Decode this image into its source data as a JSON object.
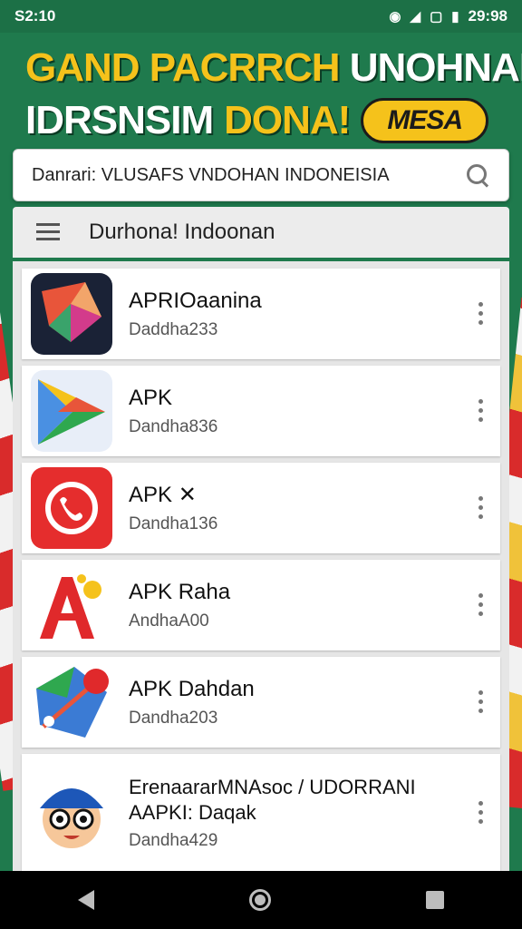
{
  "status_bar": {
    "time": "S2:10",
    "clock_right": "29:98"
  },
  "banner": {
    "line1_yellow": "GAND PACRRCH",
    "line1_white": "UNOHNAN",
    "line2_white": "IDRSNSIM",
    "line2_yellow": "DONA!",
    "pill": "MESA"
  },
  "search": {
    "value": "Danrari: VLUSAFS VNDOHAN INDONEISIA"
  },
  "title_bar": {
    "title": "Durhona! Indoonan"
  },
  "apps": [
    {
      "name": "APRIOaanina",
      "sub": "Daddha233",
      "icon": "origami-app-icon"
    },
    {
      "name": "APK",
      "sub": "Dandha836",
      "icon": "play-triangle-app-icon"
    },
    {
      "name": "APK ✕",
      "sub": "Dandha136",
      "icon": "phone-app-icon"
    },
    {
      "name": "APK Raha",
      "sub": "AndhaA00",
      "icon": "letter-a-app-icon"
    },
    {
      "name": "APK Dahdan",
      "sub": "Dandha203",
      "icon": "map-app-icon"
    },
    {
      "name": "ErenaararMNAsoc / UDORRANI",
      "name2": "AAPKI: Daqak",
      "sub": "Dandha429",
      "icon": "mascot-app-icon"
    }
  ],
  "colors": {
    "background": "#1f7a4d",
    "banner_yellow": "#f5c21b",
    "nav_bar": "#000000"
  }
}
